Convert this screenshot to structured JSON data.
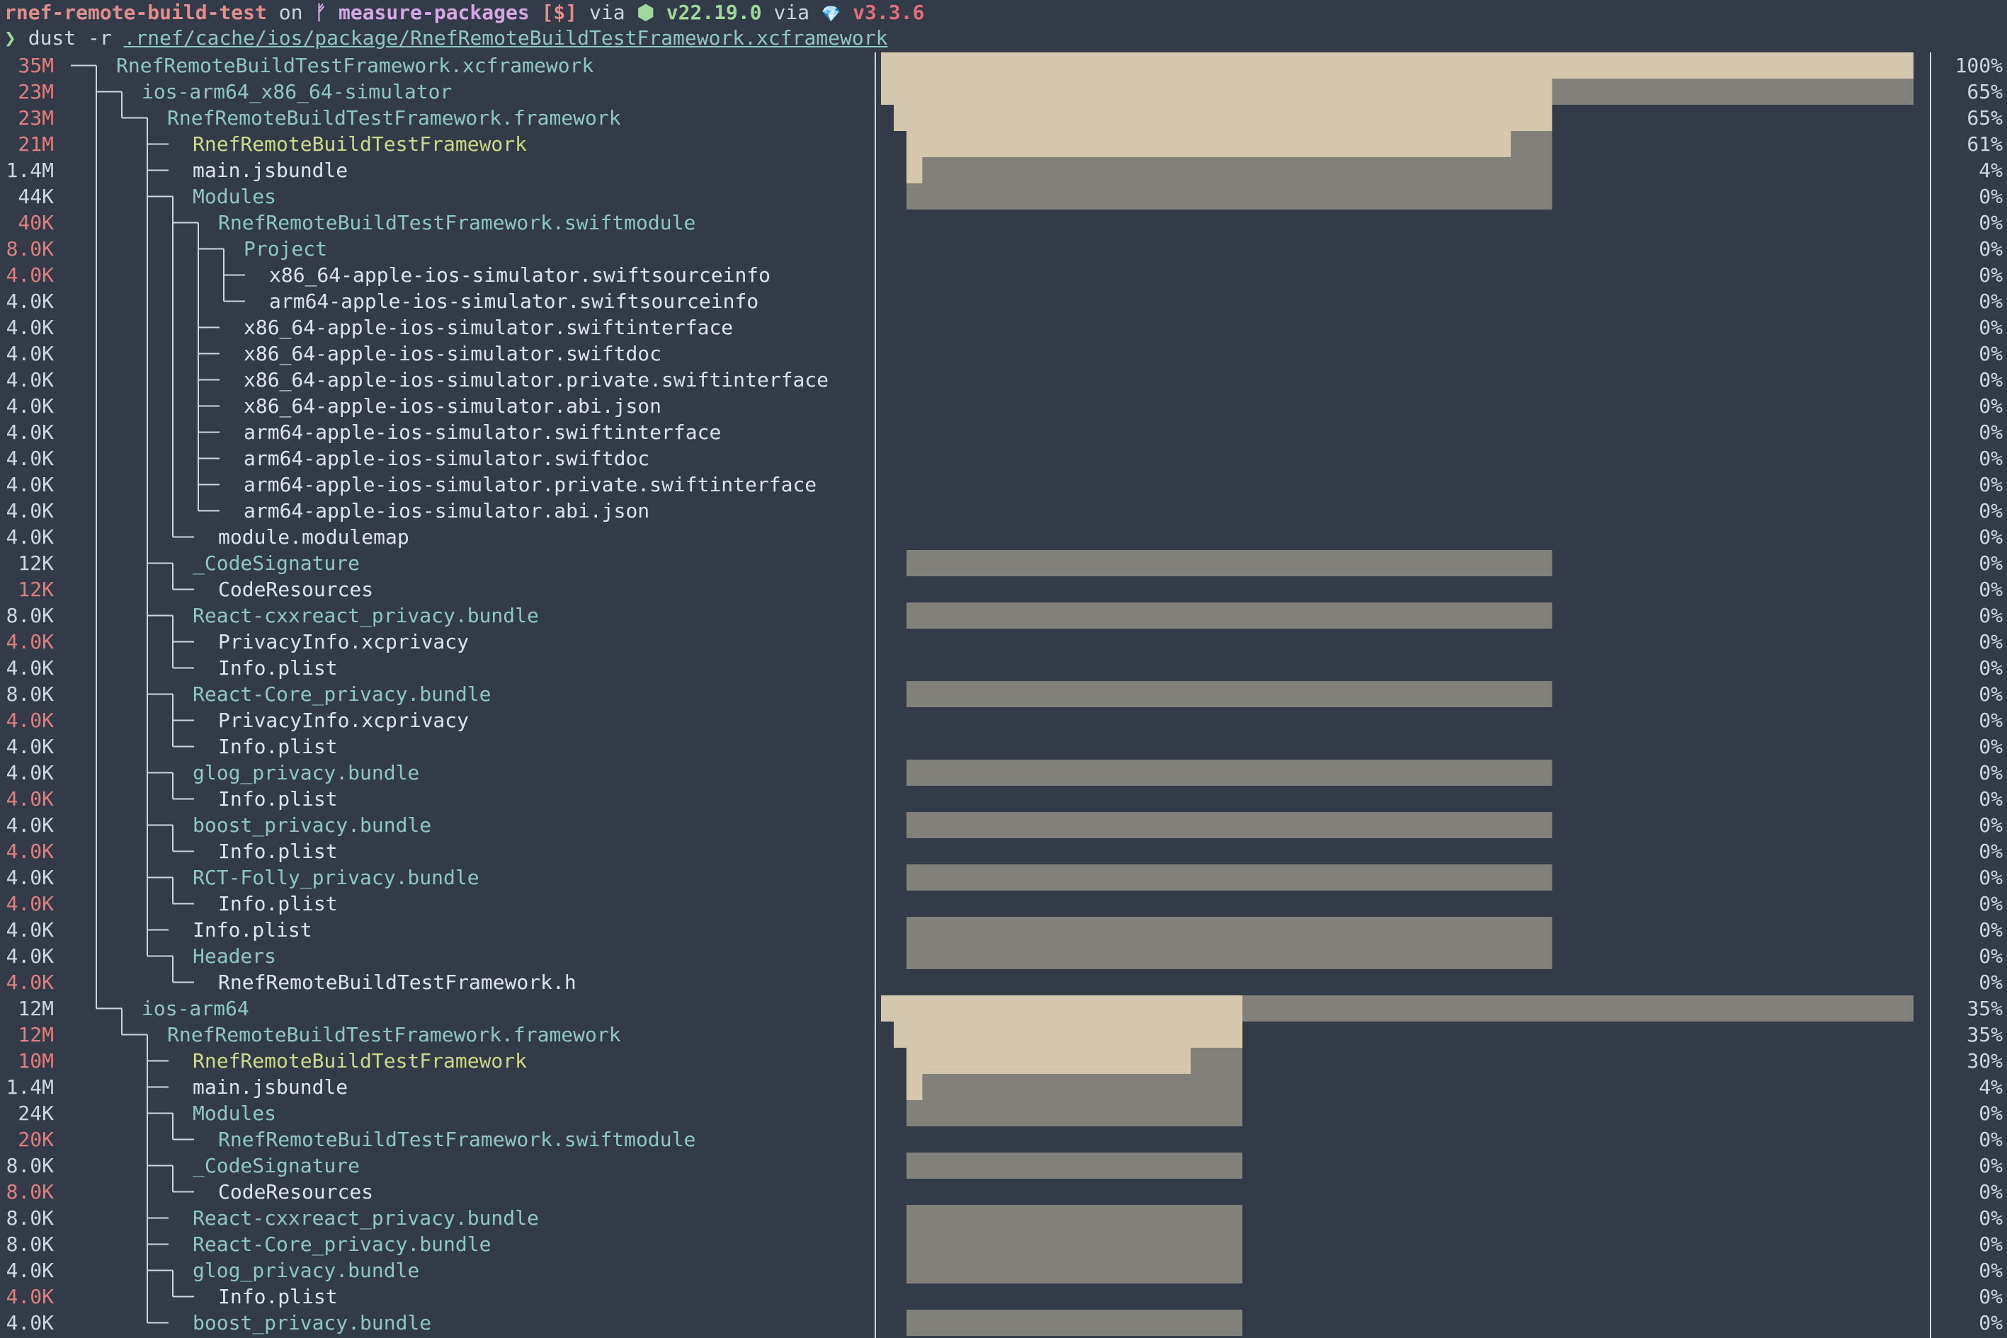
{
  "prompt": {
    "directory": "rnef-remote-build-test",
    "on_text": " on ",
    "branch_icon": "ᚠ",
    "branch": "measure-packages",
    "git_status": "[$]",
    "via_text": " via ",
    "node_icon": "⬢",
    "node_version": "v22.19.0",
    "ruby_icon": "💎",
    "ruby_version": "v3.3.6",
    "prompt_char": "❯",
    "command": "dust -r ",
    "command_path": ".rnef/cache/ios/package/RnefRemoteBuildTestFramework.xcframework"
  },
  "icons": {
    "branch": "git-branch-icon",
    "node": "nodejs-icon",
    "ruby": "ruby-gem-icon",
    "prompt": "prompt-chevron-icon"
  },
  "colors": {
    "background": "#343b48",
    "bar_light": "#d4c7ad",
    "bar_dark": "#82807a",
    "dir": "#8fc7c5",
    "binary": "#cfd98a",
    "size_red": "#e07f80"
  },
  "rows": [
    {
      "size": "35M",
      "name": "RnefRemoteBuildTestFramework.xcframework",
      "pct": "100%",
      "depth": 0,
      "kind": "dir",
      "red": true,
      "fraction": 1.0
    },
    {
      "size": "23M",
      "name": "ios-arm64_x86_64-simulator",
      "pct": "65%",
      "depth": 1,
      "kind": "dir",
      "red": true,
      "fraction": 0.65
    },
    {
      "size": "23M",
      "name": "RnefRemoteBuildTestFramework.framework",
      "pct": "65%",
      "depth": 2,
      "kind": "dir",
      "red": true,
      "fraction": 0.65
    },
    {
      "size": "21M",
      "name": "RnefRemoteBuildTestFramework",
      "pct": "61%",
      "depth": 3,
      "kind": "bin",
      "red": true,
      "fraction": 0.61
    },
    {
      "size": "1.4M",
      "name": "main.jsbundle",
      "pct": "4%",
      "depth": 3,
      "kind": "file",
      "red": false,
      "fraction": 0.04
    },
    {
      "size": "44K",
      "name": "Modules",
      "pct": "0%",
      "depth": 3,
      "kind": "dir",
      "red": false,
      "fraction": 0
    },
    {
      "size": "40K",
      "name": "RnefRemoteBuildTestFramework.swiftmodule",
      "pct": "0%",
      "depth": 4,
      "kind": "dir",
      "red": true,
      "fraction": 0
    },
    {
      "size": "8.0K",
      "name": "Project",
      "pct": "0%",
      "depth": 5,
      "kind": "dir",
      "red": true,
      "fraction": 0
    },
    {
      "size": "4.0K",
      "name": "x86_64-apple-ios-simulator.swiftsourceinfo",
      "pct": "0%",
      "depth": 6,
      "kind": "file",
      "red": true,
      "fraction": 0
    },
    {
      "size": "4.0K",
      "name": "arm64-apple-ios-simulator.swiftsourceinfo",
      "pct": "0%",
      "depth": 6,
      "kind": "file",
      "red": false,
      "fraction": 0
    },
    {
      "size": "4.0K",
      "name": "x86_64-apple-ios-simulator.swiftinterface",
      "pct": "0%",
      "depth": 5,
      "kind": "file",
      "red": false,
      "fraction": 0
    },
    {
      "size": "4.0K",
      "name": "x86_64-apple-ios-simulator.swiftdoc",
      "pct": "0%",
      "depth": 5,
      "kind": "file",
      "red": false,
      "fraction": 0
    },
    {
      "size": "4.0K",
      "name": "x86_64-apple-ios-simulator.private.swiftinterface",
      "pct": "0%",
      "depth": 5,
      "kind": "file",
      "red": false,
      "fraction": 0
    },
    {
      "size": "4.0K",
      "name": "x86_64-apple-ios-simulator.abi.json",
      "pct": "0%",
      "depth": 5,
      "kind": "file",
      "red": false,
      "fraction": 0
    },
    {
      "size": "4.0K",
      "name": "arm64-apple-ios-simulator.swiftinterface",
      "pct": "0%",
      "depth": 5,
      "kind": "file",
      "red": false,
      "fraction": 0
    },
    {
      "size": "4.0K",
      "name": "arm64-apple-ios-simulator.swiftdoc",
      "pct": "0%",
      "depth": 5,
      "kind": "file",
      "red": false,
      "fraction": 0
    },
    {
      "size": "4.0K",
      "name": "arm64-apple-ios-simulator.private.swiftinterface",
      "pct": "0%",
      "depth": 5,
      "kind": "file",
      "red": false,
      "fraction": 0
    },
    {
      "size": "4.0K",
      "name": "arm64-apple-ios-simulator.abi.json",
      "pct": "0%",
      "depth": 5,
      "kind": "file",
      "red": false,
      "fraction": 0
    },
    {
      "size": "4.0K",
      "name": "module.modulemap",
      "pct": "0%",
      "depth": 4,
      "kind": "file",
      "red": false,
      "fraction": 0
    },
    {
      "size": "12K",
      "name": "_CodeSignature",
      "pct": "0%",
      "depth": 3,
      "kind": "dir",
      "red": false,
      "fraction": 0
    },
    {
      "size": "12K",
      "name": "CodeResources",
      "pct": "0%",
      "depth": 4,
      "kind": "file",
      "red": true,
      "fraction": 0
    },
    {
      "size": "8.0K",
      "name": "React-cxxreact_privacy.bundle",
      "pct": "0%",
      "depth": 3,
      "kind": "dir",
      "red": false,
      "fraction": 0
    },
    {
      "size": "4.0K",
      "name": "PrivacyInfo.xcprivacy",
      "pct": "0%",
      "depth": 4,
      "kind": "file",
      "red": true,
      "fraction": 0
    },
    {
      "size": "4.0K",
      "name": "Info.plist",
      "pct": "0%",
      "depth": 4,
      "kind": "file",
      "red": false,
      "fraction": 0
    },
    {
      "size": "8.0K",
      "name": "React-Core_privacy.bundle",
      "pct": "0%",
      "depth": 3,
      "kind": "dir",
      "red": false,
      "fraction": 0
    },
    {
      "size": "4.0K",
      "name": "PrivacyInfo.xcprivacy",
      "pct": "0%",
      "depth": 4,
      "kind": "file",
      "red": true,
      "fraction": 0
    },
    {
      "size": "4.0K",
      "name": "Info.plist",
      "pct": "0%",
      "depth": 4,
      "kind": "file",
      "red": false,
      "fraction": 0
    },
    {
      "size": "4.0K",
      "name": "glog_privacy.bundle",
      "pct": "0%",
      "depth": 3,
      "kind": "dir",
      "red": false,
      "fraction": 0
    },
    {
      "size": "4.0K",
      "name": "Info.plist",
      "pct": "0%",
      "depth": 4,
      "kind": "file",
      "red": true,
      "fraction": 0
    },
    {
      "size": "4.0K",
      "name": "boost_privacy.bundle",
      "pct": "0%",
      "depth": 3,
      "kind": "dir",
      "red": false,
      "fraction": 0
    },
    {
      "size": "4.0K",
      "name": "Info.plist",
      "pct": "0%",
      "depth": 4,
      "kind": "file",
      "red": true,
      "fraction": 0
    },
    {
      "size": "4.0K",
      "name": "RCT-Folly_privacy.bundle",
      "pct": "0%",
      "depth": 3,
      "kind": "dir",
      "red": false,
      "fraction": 0
    },
    {
      "size": "4.0K",
      "name": "Info.plist",
      "pct": "0%",
      "depth": 4,
      "kind": "file",
      "red": true,
      "fraction": 0
    },
    {
      "size": "4.0K",
      "name": "Info.plist",
      "pct": "0%",
      "depth": 3,
      "kind": "file",
      "red": false,
      "fraction": 0
    },
    {
      "size": "4.0K",
      "name": "Headers",
      "pct": "0%",
      "depth": 3,
      "kind": "dir",
      "red": false,
      "fraction": 0
    },
    {
      "size": "4.0K",
      "name": "RnefRemoteBuildTestFramework.h",
      "pct": "0%",
      "depth": 4,
      "kind": "file",
      "red": true,
      "fraction": 0
    },
    {
      "size": "12M",
      "name": "ios-arm64",
      "pct": "35%",
      "depth": 1,
      "kind": "dir",
      "red": false,
      "fraction": 0.35
    },
    {
      "size": "12M",
      "name": "RnefRemoteBuildTestFramework.framework",
      "pct": "35%",
      "depth": 2,
      "kind": "dir",
      "red": true,
      "fraction": 0.35
    },
    {
      "size": "10M",
      "name": "RnefRemoteBuildTestFramework",
      "pct": "30%",
      "depth": 3,
      "kind": "bin",
      "red": true,
      "fraction": 0.3
    },
    {
      "size": "1.4M",
      "name": "main.jsbundle",
      "pct": "4%",
      "depth": 3,
      "kind": "file",
      "red": false,
      "fraction": 0.04
    },
    {
      "size": "24K",
      "name": "Modules",
      "pct": "0%",
      "depth": 3,
      "kind": "dir",
      "red": false,
      "fraction": 0
    },
    {
      "size": "20K",
      "name": "RnefRemoteBuildTestFramework.swiftmodule",
      "pct": "0%",
      "depth": 4,
      "kind": "dir",
      "red": true,
      "fraction": 0
    },
    {
      "size": "8.0K",
      "name": "_CodeSignature",
      "pct": "0%",
      "depth": 3,
      "kind": "dir",
      "red": false,
      "fraction": 0
    },
    {
      "size": "8.0K",
      "name": "CodeResources",
      "pct": "0%",
      "depth": 4,
      "kind": "file",
      "red": true,
      "fraction": 0
    },
    {
      "size": "8.0K",
      "name": "React-cxxreact_privacy.bundle",
      "pct": "0%",
      "depth": 3,
      "kind": "dir",
      "red": false,
      "fraction": 0
    },
    {
      "size": "8.0K",
      "name": "React-Core_privacy.bundle",
      "pct": "0%",
      "depth": 3,
      "kind": "dir",
      "red": false,
      "fraction": 0
    },
    {
      "size": "4.0K",
      "name": "glog_privacy.bundle",
      "pct": "0%",
      "depth": 3,
      "kind": "dir",
      "red": false,
      "fraction": 0
    },
    {
      "size": "4.0K",
      "name": "Info.plist",
      "pct": "0%",
      "depth": 4,
      "kind": "file",
      "red": true,
      "fraction": 0
    },
    {
      "size": "4.0K",
      "name": "boost_privacy.bundle",
      "pct": "0%",
      "depth": 3,
      "kind": "dir",
      "red": false,
      "fraction": 0
    }
  ]
}
